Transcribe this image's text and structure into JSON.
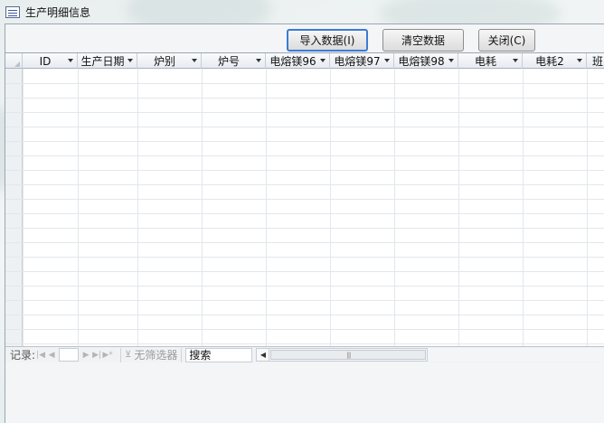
{
  "window": {
    "title": "生产明细信息"
  },
  "toolbar": {
    "import_label": "导入数据(I)",
    "clear_label": "清空数据",
    "close_label": "关闭(C)"
  },
  "grid": {
    "columns": [
      "ID",
      "生产日期",
      "炉别",
      "炉号",
      "电熔镁96",
      "电熔镁97",
      "电熔镁98",
      "电耗",
      "电耗2",
      "班"
    ],
    "rows": []
  },
  "navigation": {
    "record_label": "记录:",
    "first_icon": "first-record-icon",
    "prev_icon": "prev-record-icon",
    "next_icon": "next-record-icon",
    "last_icon": "last-record-icon",
    "new_icon": "new-record-icon",
    "filter_label": "无筛选器",
    "search_label": "搜索"
  },
  "colors": {
    "accent_focus": "#3a7bd5",
    "header_bg": "#e7ebf0",
    "grid_line": "#e3e7eb"
  }
}
